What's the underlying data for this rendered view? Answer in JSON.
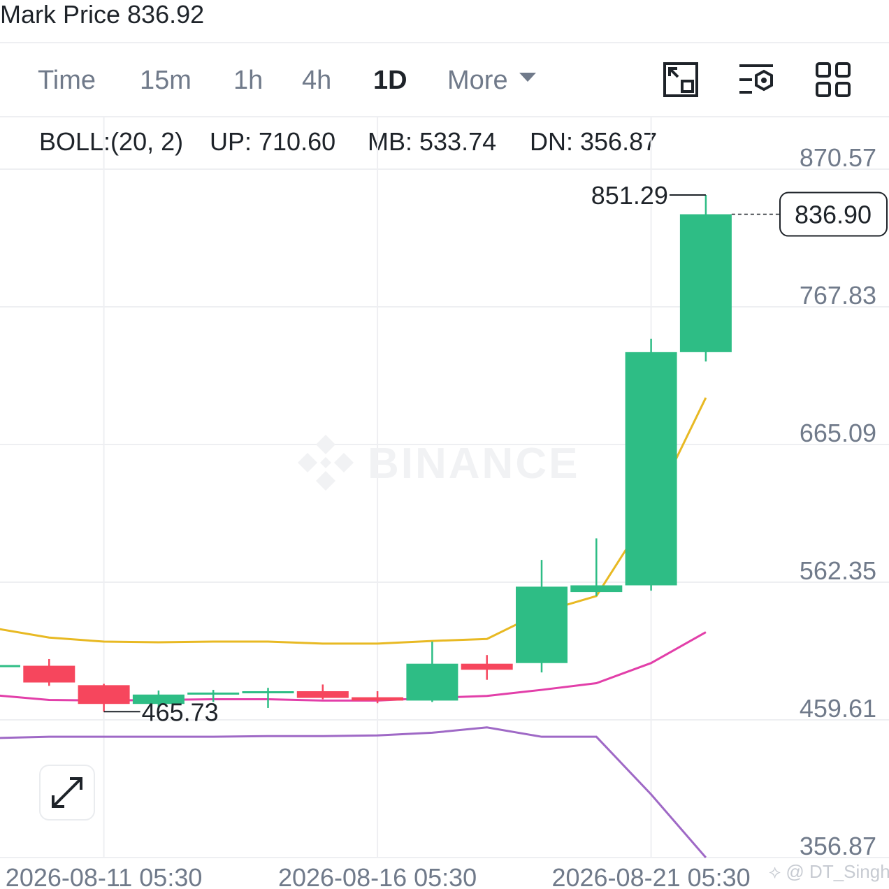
{
  "header": {
    "mark_price_text": "Mark Price 836.92"
  },
  "interval_tabs": [
    {
      "label": "Time",
      "active": false
    },
    {
      "label": "15m",
      "active": false
    },
    {
      "label": "1h",
      "active": false
    },
    {
      "label": "4h",
      "active": false
    },
    {
      "label": "1D",
      "active": true
    }
  ],
  "more_tab": {
    "label": "More"
  },
  "toolbar_icons": [
    "resize-window-icon",
    "indicator-settings-icon",
    "grid-layout-icon"
  ],
  "indicator": {
    "name": "BOLL:(20, 2)",
    "up": "UP: 710.60",
    "mb": "MB: 533.74",
    "dn": "DN: 356.87",
    "colors": {
      "name": "#e8b923",
      "up": "#e8b923",
      "mb": "#e23fa9",
      "dn": "#9f69c6"
    }
  },
  "watermark": {
    "text": "BINANCE"
  },
  "credit": {
    "text": "@ DT_Singh"
  },
  "chart_data": {
    "type": "candlestick",
    "y_axis_ticks": [
      870.57,
      767.83,
      665.09,
      562.35,
      459.61,
      356.87
    ],
    "ylim": [
      356.87,
      870.57
    ],
    "x_axis_ticks": [
      "2026-08-11 05:30",
      "2026-08-16 05:30",
      "2026-08-21 05:30"
    ],
    "colors": {
      "up": "#2ebd85",
      "down": "#f6465d"
    },
    "candles": [
      {
        "open": 500.0,
        "high": 500.5,
        "low": 498.5,
        "close": 500.5
      },
      {
        "open": 500.0,
        "high": 505.0,
        "low": 485.0,
        "close": 487.5
      },
      {
        "open": 485.5,
        "high": 486.5,
        "low": 465.73,
        "close": 471.5
      },
      {
        "open": 471.5,
        "high": 481.5,
        "low": 467.5,
        "close": 478.5
      },
      {
        "open": 478.5,
        "high": 482.0,
        "low": 473.0,
        "close": 480.0
      },
      {
        "open": 480.0,
        "high": 483.5,
        "low": 468.5,
        "close": 481.0
      },
      {
        "open": 481.0,
        "high": 486.0,
        "low": 475.0,
        "close": 476.0
      },
      {
        "open": 476.5,
        "high": 481.0,
        "low": 472.0,
        "close": 474.0
      },
      {
        "open": 474.0,
        "high": 518.0,
        "low": 473.0,
        "close": 501.5
      },
      {
        "open": 501.5,
        "high": 508.0,
        "low": 489.5,
        "close": 497.0
      },
      {
        "open": 502.0,
        "high": 579.0,
        "low": 495.0,
        "close": 559.0
      },
      {
        "open": 555.0,
        "high": 595.0,
        "low": 552.0,
        "close": 560.0
      },
      {
        "open": 560.0,
        "high": 744.0,
        "low": 556.0,
        "close": 734.0
      },
      {
        "open": 734.0,
        "high": 851.29,
        "low": 727.0,
        "close": 836.9
      }
    ],
    "boll_up": [
      528.0,
      521.0,
      518.0,
      517.5,
      518.0,
      518.0,
      516.5,
      516.5,
      518.5,
      520.0,
      540.0,
      552.0,
      616.0,
      700.0
    ],
    "boll_mb": [
      478.0,
      474.5,
      474.0,
      474.5,
      475.0,
      475.0,
      474.0,
      474.0,
      476.0,
      477.5,
      482.0,
      487.0,
      502.0,
      525.0
    ],
    "boll_dn": [
      446.0,
      447.0,
      447.0,
      447.0,
      447.0,
      447.5,
      447.5,
      448.0,
      450.0,
      454.0,
      447.0,
      447.0,
      404.0,
      356.87
    ],
    "high_label": "851.29",
    "low_label": "465.73",
    "last_price_label": "836.90"
  }
}
